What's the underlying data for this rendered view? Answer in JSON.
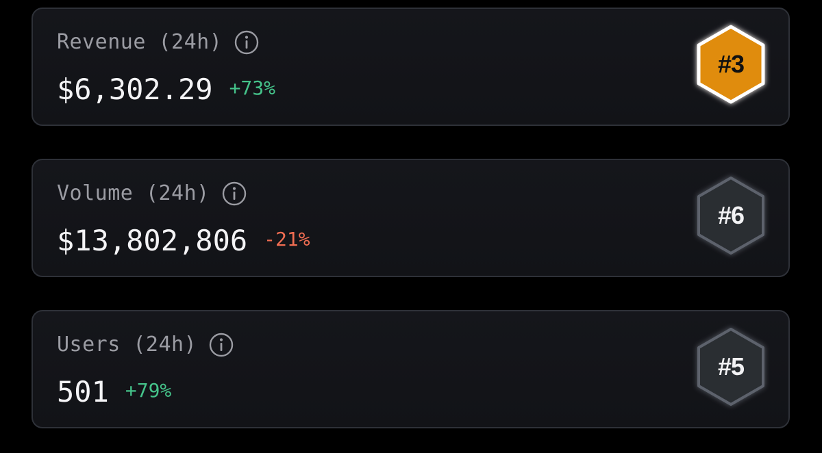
{
  "colors": {
    "background": "#000000",
    "card_bg": "#15161b",
    "card_border": "#2e3138",
    "label": "#9b9ca3",
    "value": "#f4f4f6",
    "positive": "#45c38a",
    "negative": "#f06d52",
    "badge_gold": "#e08c0e",
    "badge_dark": "#2a2d33"
  },
  "metrics": [
    {
      "label": "Revenue (24h)",
      "value": "$6,302.29",
      "change": "+73%",
      "direction": "positive",
      "rank": "#3",
      "badge_style": "gold",
      "info_icon": "info-circle-icon"
    },
    {
      "label": "Volume (24h)",
      "value": "$13,802,806",
      "change": "-21%",
      "direction": "negative",
      "rank": "#6",
      "badge_style": "dark",
      "info_icon": "info-circle-icon"
    },
    {
      "label": "Users (24h)",
      "value": "501",
      "change": "+79%",
      "direction": "positive",
      "rank": "#5",
      "badge_style": "dark",
      "info_icon": "info-circle-icon"
    }
  ]
}
